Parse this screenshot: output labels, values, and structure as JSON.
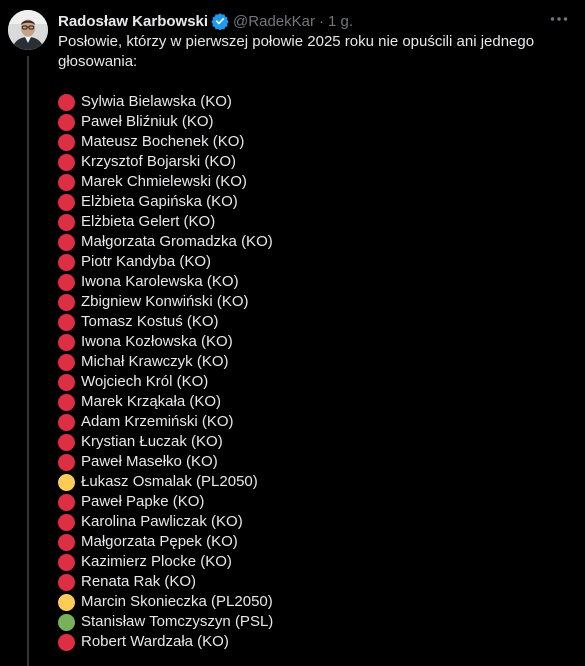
{
  "post": {
    "author_name": "Radosław Karbowski",
    "handle": "@RadekKar",
    "separator": "·",
    "time": "1 g.",
    "intro_text": "Posłowie, którzy w pierwszej połowie 2025 roku nie opuścili ani jednego głosowania:"
  },
  "colors": {
    "red": "#dd2e44",
    "yellow": "#fdcb58",
    "green": "#78b159",
    "verified": "#1d9bf0"
  },
  "members": [
    {
      "name": "Sylwia Bielawska (KO)",
      "color": "red"
    },
    {
      "name": "Paweł Bliźniuk (KO)",
      "color": "red"
    },
    {
      "name": "Mateusz Bochenek (KO)",
      "color": "red"
    },
    {
      "name": "Krzysztof Bojarski (KO)",
      "color": "red"
    },
    {
      "name": "Marek Chmielewski (KO)",
      "color": "red"
    },
    {
      "name": "Elżbieta Gapińska (KO)",
      "color": "red"
    },
    {
      "name": "Elżbieta Gelert (KO)",
      "color": "red"
    },
    {
      "name": "Małgorzata Gromadzka (KO)",
      "color": "red"
    },
    {
      "name": "Piotr Kandyba (KO)",
      "color": "red"
    },
    {
      "name": "Iwona Karolewska (KO)",
      "color": "red"
    },
    {
      "name": "Zbigniew Konwiński (KO)",
      "color": "red"
    },
    {
      "name": "Tomasz Kostuś (KO)",
      "color": "red"
    },
    {
      "name": "Iwona Kozłowska (KO)",
      "color": "red"
    },
    {
      "name": "Michał Krawczyk (KO)",
      "color": "red"
    },
    {
      "name": "Wojciech Król (KO)",
      "color": "red"
    },
    {
      "name": "Marek Krząkała (KO)",
      "color": "red"
    },
    {
      "name": "Adam Krzemiński (KO)",
      "color": "red"
    },
    {
      "name": "Krystian Łuczak (KO)",
      "color": "red"
    },
    {
      "name": "Paweł Masełko (KO)",
      "color": "red"
    },
    {
      "name": "Łukasz Osmalak (PL2050)",
      "color": "yellow"
    },
    {
      "name": "Paweł Papke (KO)",
      "color": "red"
    },
    {
      "name": "Karolina Pawliczak (KO)",
      "color": "red"
    },
    {
      "name": "Małgorzata Pępek (KO)",
      "color": "red"
    },
    {
      "name": "Kazimierz Plocke (KO)",
      "color": "red"
    },
    {
      "name": "Renata Rak (KO)",
      "color": "red"
    },
    {
      "name": "Marcin Skonieczka (PL2050)",
      "color": "yellow"
    },
    {
      "name": "Stanisław Tomczyszyn (PSL)",
      "color": "green"
    },
    {
      "name": "Robert Wardzała (KO)",
      "color": "red"
    }
  ]
}
